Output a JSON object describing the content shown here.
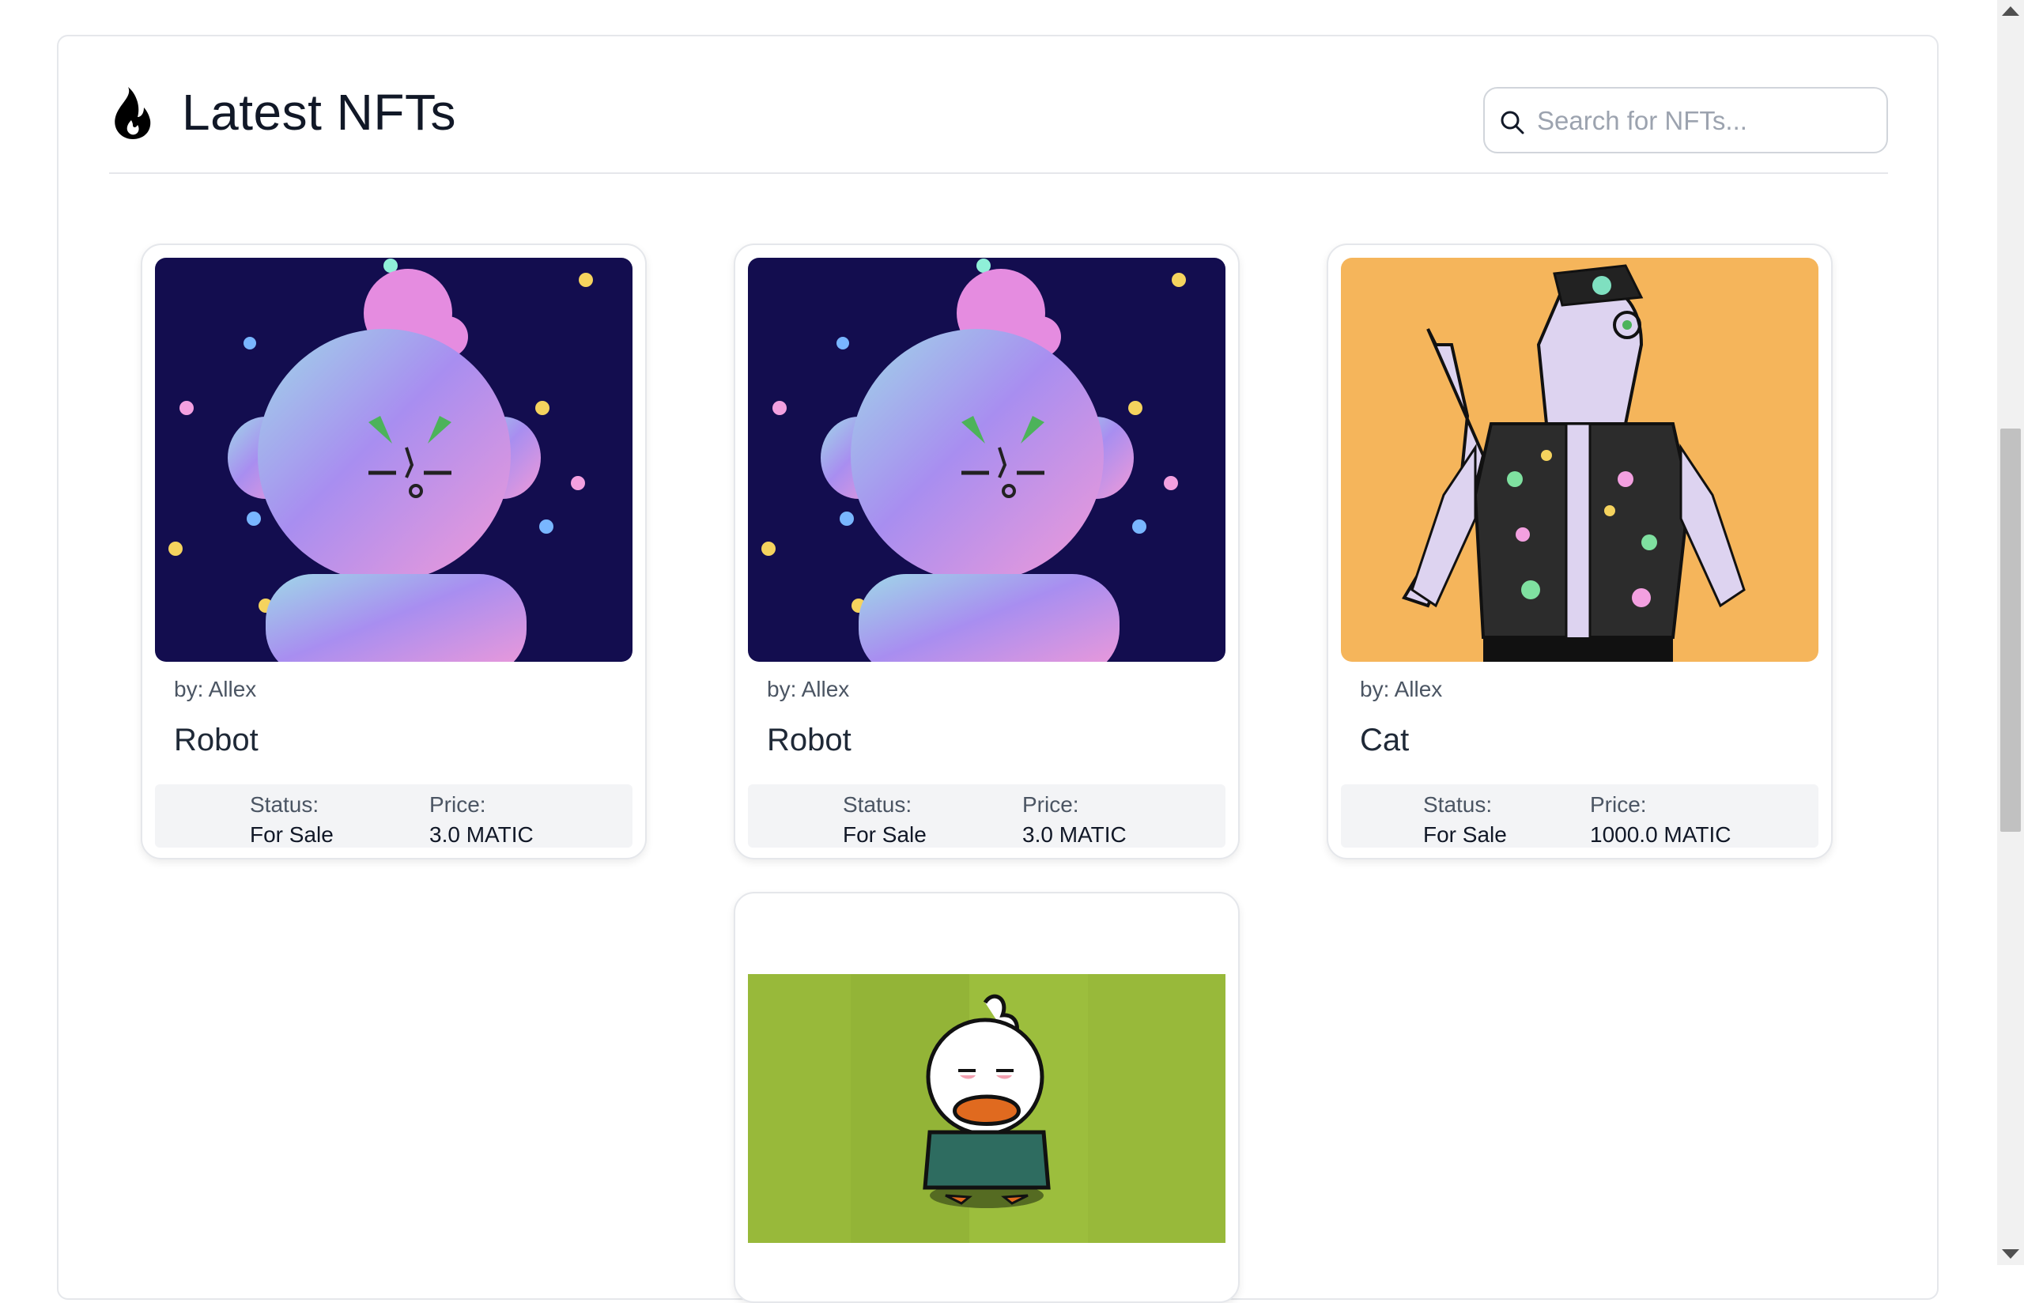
{
  "section": {
    "title": "Latest NFTs",
    "icon": "flame-icon"
  },
  "search": {
    "placeholder": "Search for NFTs...",
    "value": "",
    "icon": "search-icon"
  },
  "labels": {
    "status": "Status:",
    "price": "Price:"
  },
  "cards": [
    {
      "author": "by: Allex",
      "name": "Robot",
      "status": "For Sale",
      "price": "3.0 MATIC",
      "image": "robot-nft-image"
    },
    {
      "author": "by: Allex",
      "name": "Robot",
      "status": "For Sale",
      "price": "3.0 MATIC",
      "image": "robot-nft-image"
    },
    {
      "author": "by: Allex",
      "name": "Cat",
      "status": "For Sale",
      "price": "1000.0 MATIC",
      "image": "zebra-cat-nft-image"
    },
    {
      "image": "duck-nft-image"
    }
  ],
  "colors": {
    "robot_bg": "#130d4f",
    "cat_bg": "#f5b55b",
    "duck_bg": "#98b93a",
    "stats_bg": "#f3f4f6"
  }
}
